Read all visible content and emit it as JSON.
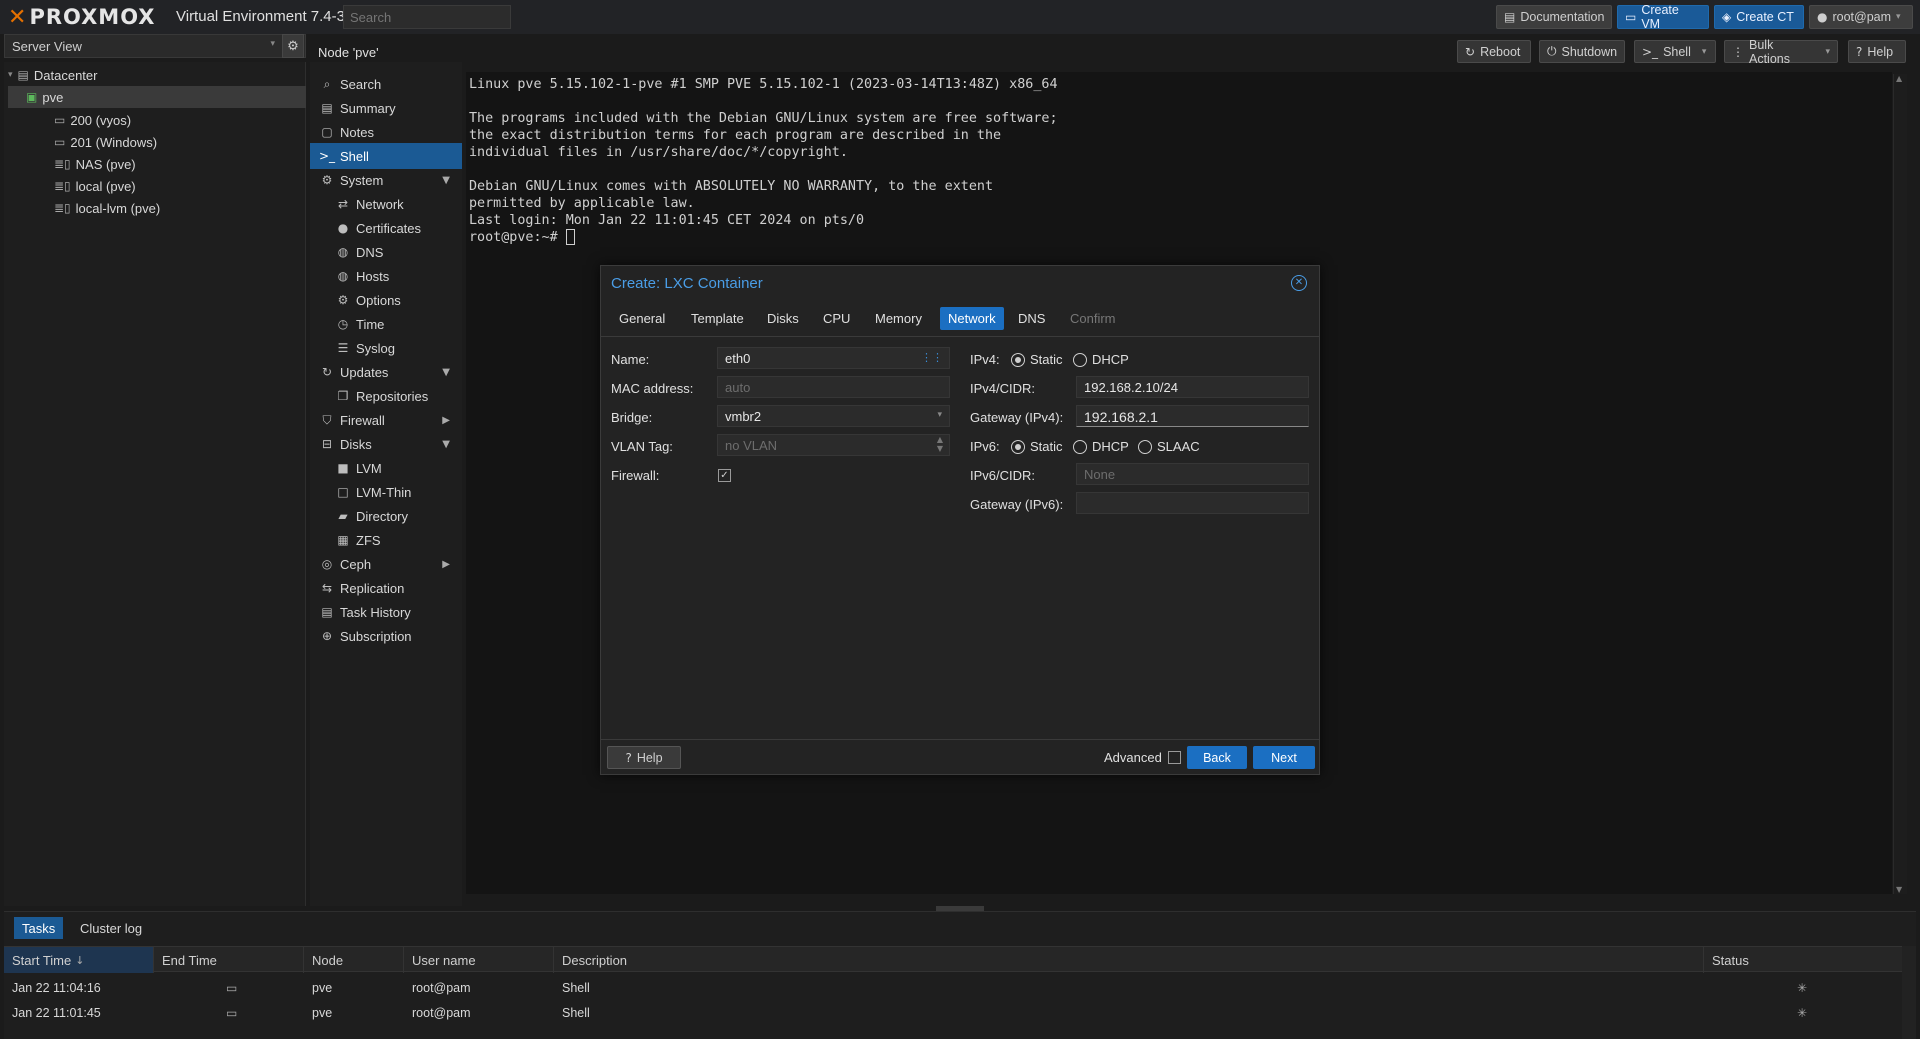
{
  "app": {
    "logo_text": "PROXMOX",
    "version_label": "Virtual Environment 7.4-3",
    "search_placeholder": "Search"
  },
  "topbar_buttons": {
    "documentation": "Documentation",
    "create_vm": "Create VM",
    "create_ct": "Create CT",
    "user": "root@pam"
  },
  "server_view": "Server View",
  "node_title": "Node 'pve'",
  "header_buttons": {
    "reboot": "Reboot",
    "shutdown": "Shutdown",
    "shell": "Shell",
    "bulk_actions": "Bulk Actions",
    "help": "Help"
  },
  "tree": {
    "datacenter": "Datacenter",
    "node": "pve",
    "items": [
      "200 (vyos)",
      "201 (Windows)",
      "NAS (pve)",
      "local (pve)",
      "local-lvm (pve)"
    ]
  },
  "menu": {
    "search": "Search",
    "summary": "Summary",
    "notes": "Notes",
    "shell": "Shell",
    "system": "System",
    "network": "Network",
    "certificates": "Certificates",
    "dns": "DNS",
    "hosts": "Hosts",
    "options": "Options",
    "time": "Time",
    "syslog": "Syslog",
    "updates": "Updates",
    "repositories": "Repositories",
    "firewall": "Firewall",
    "disks": "Disks",
    "lvm": "LVM",
    "lvm_thin": "LVM-Thin",
    "directory": "Directory",
    "zfs": "ZFS",
    "ceph": "Ceph",
    "replication": "Replication",
    "task_history": "Task History",
    "subscription": "Subscription"
  },
  "terminal": {
    "lines": [
      "Linux pve 5.15.102-1-pve #1 SMP PVE 5.15.102-1 (2023-03-14T13:48Z) x86_64",
      "",
      "The programs included with the Debian GNU/Linux system are free software;",
      "the exact distribution terms for each program are described in the",
      "individual files in /usr/share/doc/*/copyright.",
      "",
      "Debian GNU/Linux comes with ABSOLUTELY NO WARRANTY, to the extent",
      "permitted by applicable law.",
      "Last login: Mon Jan 22 11:01:45 CET 2024 on pts/0"
    ],
    "prompt": "root@pve:~# "
  },
  "dialog": {
    "title": "Create: LXC Container",
    "tabs": [
      "General",
      "Template",
      "Disks",
      "CPU",
      "Memory",
      "Network",
      "DNS",
      "Confirm"
    ],
    "active_tab": "Network",
    "left": {
      "name_label": "Name:",
      "name_value": "eth0",
      "mac_label": "MAC address:",
      "mac_placeholder": "auto",
      "bridge_label": "Bridge:",
      "bridge_value": "vmbr2",
      "vlan_label": "VLAN Tag:",
      "vlan_placeholder": "no VLAN",
      "firewall_label": "Firewall:",
      "firewall_checked": true
    },
    "right": {
      "ipv4_label": "IPv4:",
      "ipv4_static": "Static",
      "ipv4_dhcp": "DHCP",
      "ipv4_cidr_label": "IPv4/CIDR:",
      "ipv4_cidr_value": "192.168.2.10/24",
      "gw4_label": "Gateway (IPv4):",
      "gw4_value": "192.168.2.1",
      "ipv6_label": "IPv6:",
      "ipv6_static": "Static",
      "ipv6_dhcp": "DHCP",
      "ipv6_slaac": "SLAAC",
      "ipv6_cidr_label": "IPv6/CIDR:",
      "ipv6_cidr_placeholder": "None",
      "gw6_label": "Gateway (IPv6):"
    },
    "footer": {
      "help": "Help",
      "advanced": "Advanced",
      "back": "Back",
      "next": "Next"
    }
  },
  "bottom": {
    "tabs": [
      "Tasks",
      "Cluster log"
    ],
    "columns": [
      "Start Time",
      "End Time",
      "Node",
      "User name",
      "Description",
      "Status"
    ],
    "rows": [
      {
        "start": "Jan 22 11:04:16",
        "node": "pve",
        "user": "root@pam",
        "desc": "Shell"
      },
      {
        "start": "Jan 22 11:01:45",
        "node": "pve",
        "user": "root@pam",
        "desc": "Shell"
      }
    ]
  },
  "colors": {
    "accent_blue": "#1b6fc2",
    "logo_orange": "#e57000",
    "title_blue": "#4a9de6"
  }
}
